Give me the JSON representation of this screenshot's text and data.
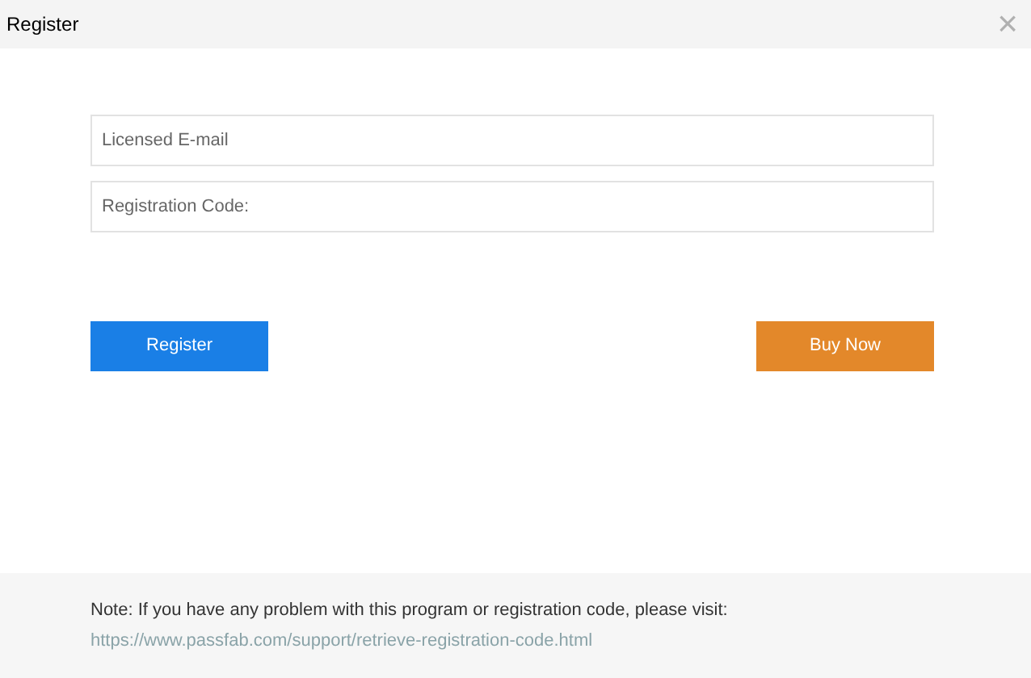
{
  "window": {
    "title": "Register",
    "close": "×"
  },
  "fields": [
    {
      "placeholder": "Licensed E-mail"
    },
    {
      "placeholder": "Registration Code:"
    }
  ],
  "buttons": [
    {
      "kind": "primary",
      "label": "Register"
    },
    {
      "kind": "buy",
      "label": "Buy Now"
    }
  ],
  "note": {
    "text": "Note: If you have any problem with this program or registration code, please visit:",
    "link": "https://www.passfab.com/support/retrieve-registration-code.html"
  }
}
